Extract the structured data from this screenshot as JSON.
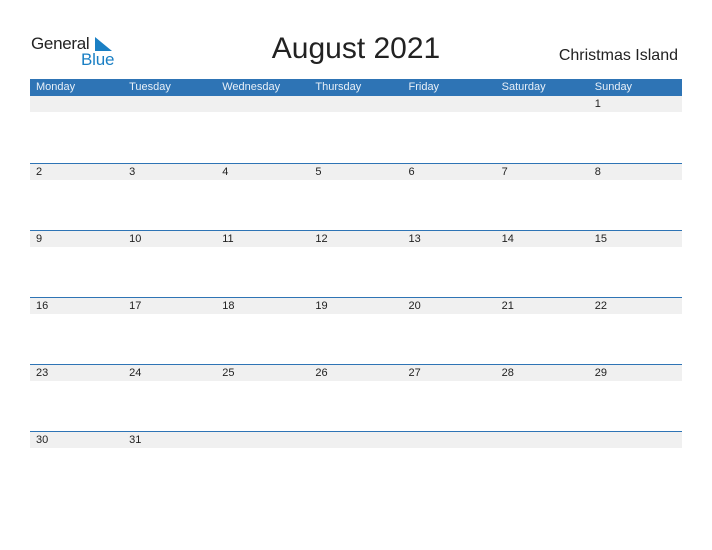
{
  "logo": {
    "line1": "General",
    "line2": "Blue",
    "icon": "triangle-flag-icon"
  },
  "title": "August 2021",
  "country": "Christmas Island",
  "colors": {
    "accent": "#2e74b5",
    "strip": "#f0f0f0",
    "logo_blue": "#1a7fc4"
  },
  "weekdays": [
    "Monday",
    "Tuesday",
    "Wednesday",
    "Thursday",
    "Friday",
    "Saturday",
    "Sunday"
  ],
  "weeks": [
    [
      "",
      "",
      "",
      "",
      "",
      "",
      "1"
    ],
    [
      "2",
      "3",
      "4",
      "5",
      "6",
      "7",
      "8"
    ],
    [
      "9",
      "10",
      "11",
      "12",
      "13",
      "14",
      "15"
    ],
    [
      "16",
      "17",
      "18",
      "19",
      "20",
      "21",
      "22"
    ],
    [
      "23",
      "24",
      "25",
      "26",
      "27",
      "28",
      "29"
    ],
    [
      "30",
      "31",
      "",
      "",
      "",
      "",
      ""
    ]
  ]
}
